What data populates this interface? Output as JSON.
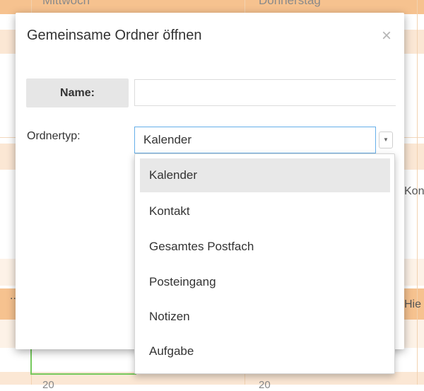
{
  "calendar": {
    "day_names": [
      "Mittwoch",
      "Donnerstag"
    ],
    "cut_labels": [
      "Kon",
      "Hie",
      ".."
    ],
    "date_numbers": [
      "20",
      "20"
    ],
    "colors": {
      "header": "#f6c28f",
      "row_tint": "#fbe7d4",
      "row_light": "#fdf2e7",
      "green": "#76c95d"
    }
  },
  "dialog": {
    "title": "Gemeinsame Ordner öffnen",
    "close_glyph": "×",
    "name_label": "Name:",
    "name_value": "",
    "type_label": "Ordnertyp:",
    "type_selected": "Kalender",
    "arrow_glyph": "▼",
    "options": [
      {
        "label": "Kalender",
        "selected": true
      },
      {
        "label": "Kontakt",
        "selected": false
      },
      {
        "label": "Gesamtes Postfach",
        "selected": false
      },
      {
        "label": "Posteingang",
        "selected": false
      },
      {
        "label": "Notizen",
        "selected": false
      },
      {
        "label": "Aufgabe",
        "selected": false
      }
    ],
    "colors": {
      "focus_border": "#66afe9",
      "highlight": "#e8e8e8",
      "label_bg": "#e6e6e6"
    }
  }
}
